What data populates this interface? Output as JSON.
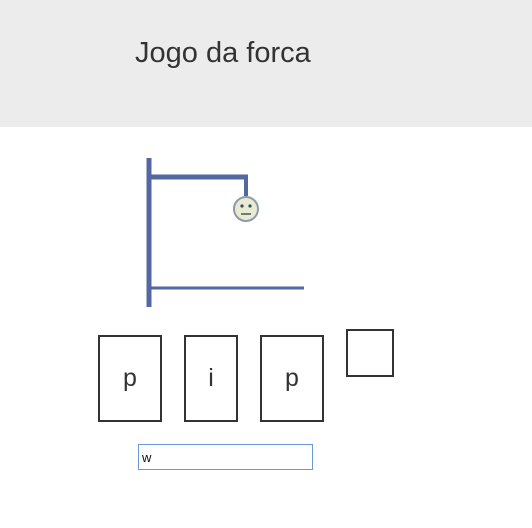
{
  "header": {
    "title": "Jogo da forca"
  },
  "game": {
    "letters": [
      "p",
      "i",
      "p",
      ""
    ],
    "guess_input": {
      "value": "w",
      "placeholder": ""
    },
    "face_icon": "neutral-face-icon"
  },
  "colors": {
    "header_bg": "#ececec",
    "gallows": "#5368a1",
    "input_focus_border": "#6a9ad6"
  }
}
